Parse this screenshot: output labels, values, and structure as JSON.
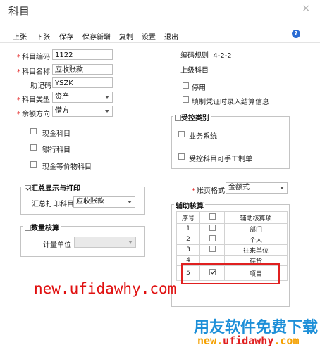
{
  "window": {
    "title": "科目",
    "close": "×"
  },
  "toolbar": {
    "items": [
      "上张",
      "下张",
      "保存",
      "保存新增",
      "复制",
      "设置",
      "退出"
    ],
    "help": "?"
  },
  "form": {
    "code_label": "科目编码",
    "code_value": "1122",
    "name_label": "科目名称",
    "name_value": "应收账款",
    "mnemonic_label": "助记码",
    "mnemonic_value": "YSZK",
    "type_label": "科目类型",
    "type_value": "资产",
    "direction_label": "余额方向",
    "direction_value": "借方",
    "required_mark": "*"
  },
  "checks": {
    "cash": {
      "label": "现金科目",
      "checked": false
    },
    "bank": {
      "label": "银行科目",
      "checked": false
    },
    "cash_eq": {
      "label": "现金等价物科目",
      "checked": false
    },
    "disabled": {
      "label": "停用",
      "checked": false
    },
    "voucher_settle": {
      "label": "填制凭证时录入结算信息",
      "checked": false
    }
  },
  "rules": {
    "label": "编码规则",
    "value": "4-2-2",
    "parent_label": "上级科目"
  },
  "summary_group": {
    "title": "汇总显示与打印",
    "checked": true,
    "print_label": "汇总打印科目",
    "print_value": "应收账款"
  },
  "qty_group": {
    "title": "数量核算",
    "checked": false,
    "unit_label": "计量单位",
    "unit_value": ""
  },
  "controlled_group": {
    "title": "受控类别",
    "checked": false,
    "business": {
      "label": "业务系统",
      "checked": false
    },
    "manual": {
      "label": "受控科目可手工制单",
      "checked": false
    }
  },
  "format": {
    "label": "账页格式",
    "value": "金额式"
  },
  "aux": {
    "title": "辅助核算",
    "headers": {
      "seq": "序号",
      "item": "辅助核算项"
    },
    "rows": [
      {
        "seq": "1",
        "item": "部门",
        "checked": false
      },
      {
        "seq": "2",
        "item": "个人",
        "checked": false
      },
      {
        "seq": "3",
        "item": "往来单位",
        "checked": false
      },
      {
        "seq": "4",
        "item": "存货",
        "checked": false
      },
      {
        "seq": "5",
        "item": "项目",
        "checked": true
      }
    ]
  },
  "watermarks": {
    "url_red": "new.ufidawhy.com",
    "brand_cn": "用友软件免费下载",
    "brand_url_a": "new.",
    "brand_url_b": "ufidawhy",
    "brand_url_c": ".com"
  },
  "colors": {
    "required": "#e32020",
    "highlight": "#e02020",
    "help": "#2b6cd3"
  }
}
